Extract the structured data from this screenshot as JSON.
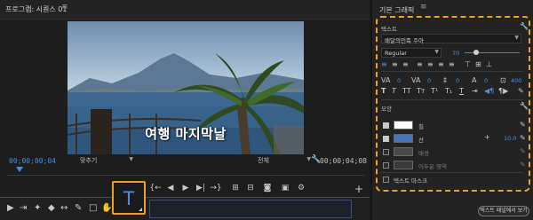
{
  "monitor": {
    "title": "프로그램: 시퀀스 01",
    "menu_icon": "≡",
    "caption": "여행 마지막날",
    "timecode_current": "00;00;00;04",
    "timecode_duration": "00;00;04;08",
    "fit_label": "맞추기",
    "quality_label": "전체",
    "transport": {
      "mark_in": "▼",
      "mark_out": "▼",
      "go_in": "{←",
      "step_back": "◀",
      "play": "▶",
      "step_fwd": "▶|",
      "go_out": "→}",
      "lift": "⊞",
      "extract": "⊟",
      "export_frame": "📷",
      "multi": "▣",
      "settings": "⚙"
    },
    "add_label": "+"
  },
  "tools": {
    "type_tool_glyph": "T",
    "items": [
      "▶",
      "⇥",
      "✦",
      "◆",
      "↔",
      "✎",
      "□",
      "✋"
    ]
  },
  "graphics_panel": {
    "title": "기본 그래픽",
    "menu_icon": "≡",
    "section_text": "텍스트",
    "font_name": "배달의민족 주아",
    "font_style": "Regular",
    "font_size": "70",
    "tracking_value": "0",
    "kerning_value": "0",
    "leading_value": "0",
    "baseline_value": "0",
    "tsume_value": "400",
    "appearance_label": "모양",
    "fill_label": "칠",
    "stroke_label": "선",
    "stroke_width": "10.0",
    "background_label": "배경",
    "shadow_label": "어두운 영역",
    "text_mask_label": "텍스트 마스크",
    "panel_button": "텍스트 패널에서 보기",
    "colors": {
      "fill": "#ffffff",
      "stroke": "#4a74b8",
      "background": "#4a4a4a",
      "shadow": "#3a3a3a",
      "accent": "#f0a020",
      "timecode": "#3f8ee8"
    }
  }
}
